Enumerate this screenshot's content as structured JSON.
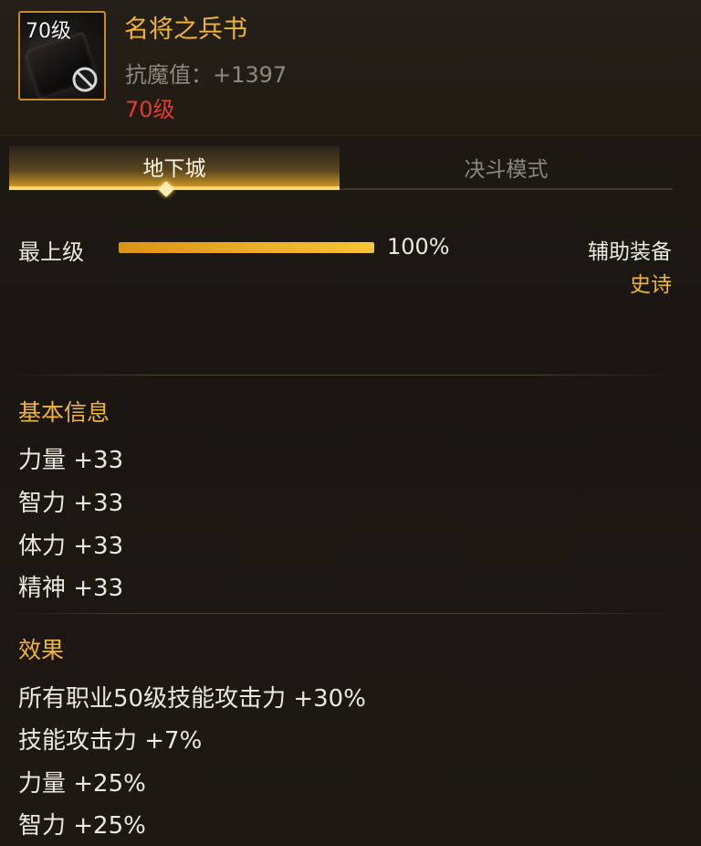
{
  "item": {
    "icon_level": "70级",
    "name": "名将之兵书",
    "stat": "抗魔值：+1397",
    "level": "70级",
    "icon_name": "book-icon",
    "badge_icon_name": "ban-icon"
  },
  "tabs": [
    {
      "label": "地下城",
      "active": true
    },
    {
      "label": "决斗模式",
      "active": false
    }
  ],
  "progress": {
    "label": "最上级",
    "value_text": "100%",
    "fraction": 1.0
  },
  "equipment": {
    "type": "辅助装备",
    "rarity": "史诗"
  },
  "basic_info": {
    "title": "基本信息",
    "lines": [
      "力量 +33",
      "智力 +33",
      "体力 +33",
      "精神 +33"
    ]
  },
  "effects": {
    "title": "效果",
    "lines": [
      "所有职业50级技能攻击力 +30%",
      "技能攻击力 +7%",
      "力量 +25%",
      "智力 +25%"
    ]
  },
  "colors": {
    "accent_gold": "#f0b43a",
    "level_red": "#e33a34",
    "background": "#1c1813"
  }
}
